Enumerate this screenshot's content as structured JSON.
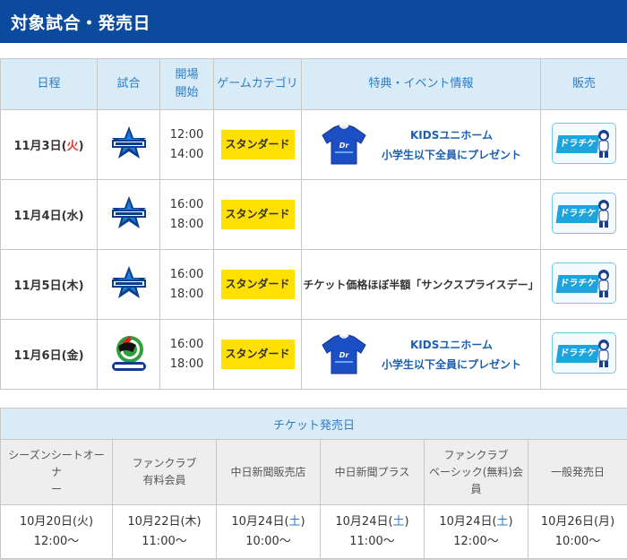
{
  "header": {
    "title": "対象試合・発売日"
  },
  "games_table": {
    "headers": [
      "日程",
      "試合",
      "開場",
      "開始",
      "ゲームカテゴリ",
      "特典・イベント情報",
      "販売"
    ],
    "rows": [
      {
        "date_pre": "11月3日(",
        "weekday": "火",
        "date_post": ")",
        "weekday_color": "#e23a3a",
        "opponent_icon": "baystars-logo",
        "open": "12:00",
        "start": "14:00",
        "category": "スタンダード",
        "event_type": "kids",
        "event_line1": "KIDSユニホーム",
        "event_line2": "小学生以下全員にプレゼント",
        "sale_label": "ドラチケ"
      },
      {
        "date_pre": "11月4日(",
        "weekday": "水",
        "date_post": ")",
        "weekday_color": "#333333",
        "opponent_icon": "baystars-logo",
        "open": "16:00",
        "start": "18:00",
        "category": "スタンダード",
        "event_type": "none",
        "event_line1": "",
        "event_line2": "",
        "sale_label": "ドラチケ"
      },
      {
        "date_pre": "11月5日(",
        "weekday": "木",
        "date_post": ")",
        "weekday_color": "#333333",
        "opponent_icon": "baystars-logo",
        "open": "16:00",
        "start": "18:00",
        "category": "スタンダード",
        "event_type": "plain",
        "event_line1": "チケット価格ほぼ半額「サンクスプライスデー」",
        "event_line2": "",
        "sale_label": "ドラチケ"
      },
      {
        "date_pre": "11月6日(",
        "weekday": "金",
        "date_post": ")",
        "weekday_color": "#333333",
        "opponent_icon": "swallows-logo",
        "open": "16:00",
        "start": "18:00",
        "category": "スタンダード",
        "event_type": "kids",
        "event_line1": "KIDSユニホーム",
        "event_line2": "小学生以下全員にプレゼント",
        "sale_label": "ドラチケ"
      }
    ]
  },
  "sale_table": {
    "title": "チケット発売日",
    "headers": [
      [
        "シーズンシートオーナ",
        "ー"
      ],
      [
        "ファンクラブ",
        "有料会員"
      ],
      [
        "中日新聞販売店"
      ],
      [
        "中日新聞プラス"
      ],
      [
        "ファンクラブ",
        "ベーシック(無料)会",
        "員"
      ],
      [
        "一般発売日"
      ]
    ],
    "dates": [
      {
        "pre": "10月20日(",
        "wd": "火",
        "post": ")",
        "sat": false,
        "time": "12:00〜"
      },
      {
        "pre": "10月22日(",
        "wd": "木",
        "post": ")",
        "sat": false,
        "time": "11:00〜"
      },
      {
        "pre": "10月24日(",
        "wd": "土",
        "post": ")",
        "sat": true,
        "time": "10:00〜"
      },
      {
        "pre": "10月24日(",
        "wd": "土",
        "post": ")",
        "sat": true,
        "time": "11:00〜"
      },
      {
        "pre": "10月24日(",
        "wd": "土",
        "post": ")",
        "sat": true,
        "time": "12:00〜"
      },
      {
        "pre": "10月26日(",
        "wd": "月",
        "post": ")",
        "sat": false,
        "time": "10:00〜"
      }
    ]
  },
  "colors": {
    "header_bg": "#0c4a9d",
    "th_bg": "#d9ebf7",
    "th_text": "#2b7ec6",
    "category_bg": "#ffe000",
    "event_text": "#1a5fb0",
    "saturday": "#2d7bd0",
    "sunday_holiday": "#e23a3a"
  }
}
